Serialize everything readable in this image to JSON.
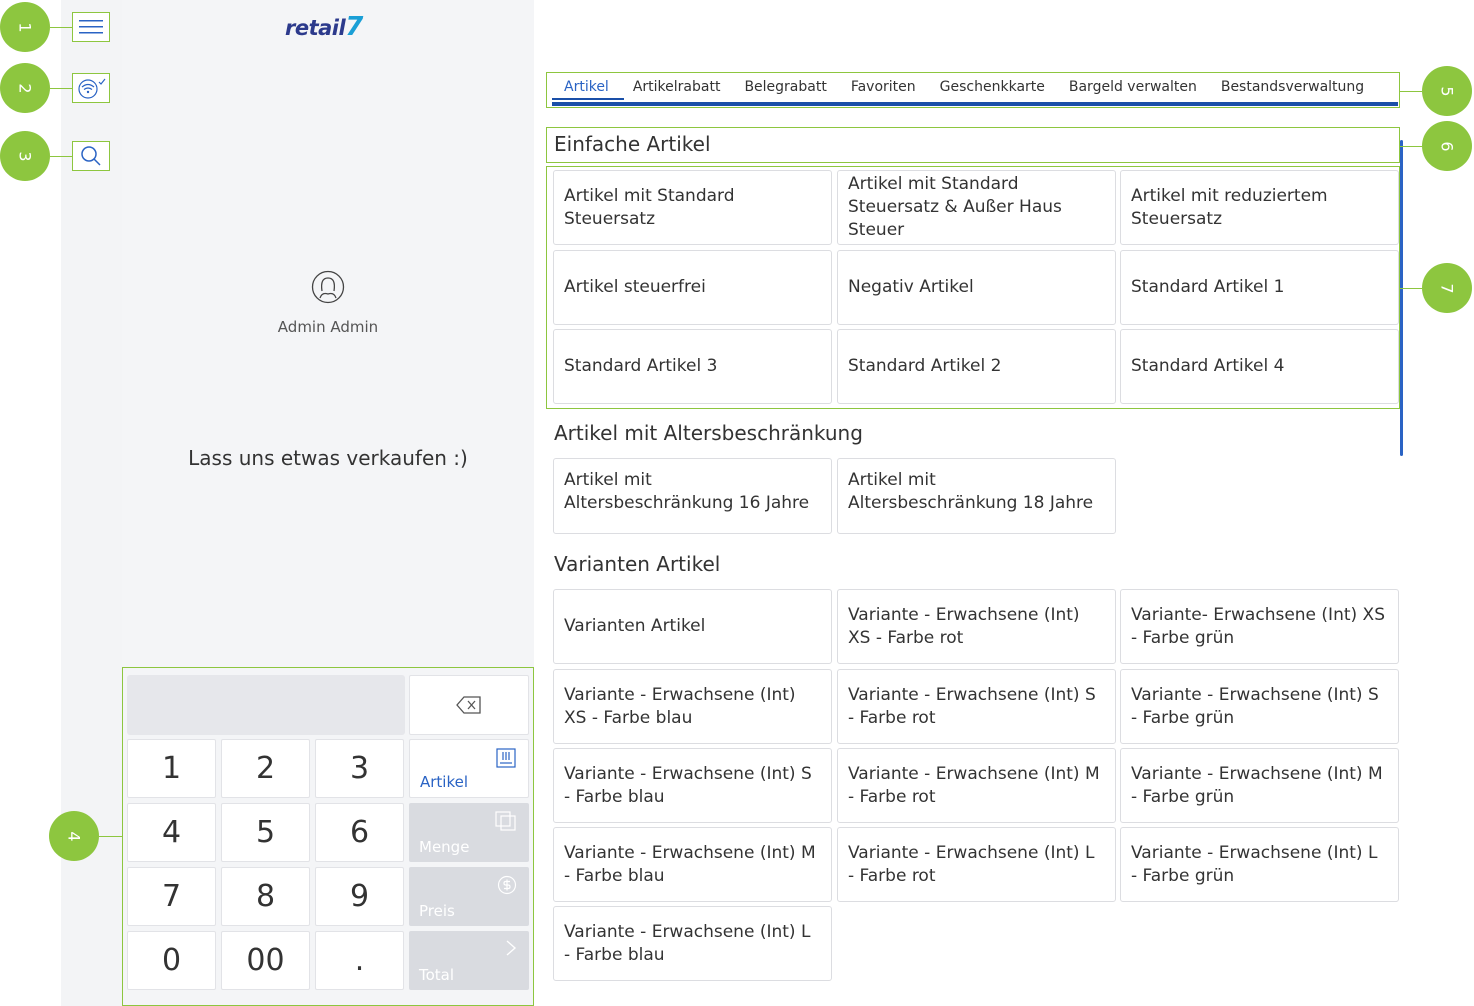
{
  "callouts": [
    "1",
    "2",
    "3",
    "4",
    "5",
    "6",
    "7"
  ],
  "brand": {
    "name": "retail",
    "mark": "7"
  },
  "user": {
    "name": "Admin Admin"
  },
  "cart": {
    "empty_message": "Lass uns etwas verkaufen :)"
  },
  "numpad": {
    "keys": [
      "1",
      "2",
      "3",
      "4",
      "5",
      "6",
      "7",
      "8",
      "9",
      "0",
      "00",
      "."
    ],
    "functions": {
      "artikel": "Artikel",
      "menge": "Menge",
      "preis": "Preis",
      "total": "Total"
    }
  },
  "tabs": [
    "Artikel",
    "Artikelrabatt",
    "Belegrabatt",
    "Favoriten",
    "Geschenkkarte",
    "Bargeld verwalten",
    "Bestandsverwaltung"
  ],
  "sections": {
    "einfache": {
      "title": "Einfache Artikel",
      "items": [
        "Artikel mit Standard Steuersatz",
        "Artikel mit Standard Steuersatz & Außer Haus Steuer",
        "Artikel mit reduziertem Steuersatz",
        "Artikel steuerfrei",
        "Negativ Artikel",
        "Standard Artikel 1",
        "Standard Artikel 3",
        "Standard Artikel 2",
        "Standard Artikel 4"
      ]
    },
    "alter": {
      "title": "Artikel mit Altersbeschränkung",
      "items": [
        "Artikel mit Altersbeschränkung 16 Jahre",
        "Artikel mit Altersbeschränkung 18 Jahre"
      ]
    },
    "varianten": {
      "title": "Varianten Artikel",
      "items": [
        "Varianten Artikel",
        "Variante - Erwachsene (Int) XS - Farbe rot",
        "Variante- Erwachsene (Int) XS - Farbe grün",
        "Variante - Erwachsene (Int) XS - Farbe blau",
        "Variante - Erwachsene (Int) S - Farbe rot",
        "Variante - Erwachsene (Int) S - Farbe grün",
        "Variante - Erwachsene (Int) S - Farbe blau",
        "Variante - Erwachsene (Int) M - Farbe rot",
        "Variante - Erwachsene (Int) M - Farbe grün",
        "Variante - Erwachsene (Int) M - Farbe blau",
        "Variante - Erwachsene (Int) L - Farbe rot",
        "Variante - Erwachsene (Int) L - Farbe grün",
        "Variante - Erwachsene (Int) L - Farbe blau"
      ]
    }
  },
  "colors": {
    "callout": "#8dc63f",
    "accent": "#2a63c4",
    "tab_bar": "#1a4fa8",
    "brand": "#2c3a8c"
  }
}
